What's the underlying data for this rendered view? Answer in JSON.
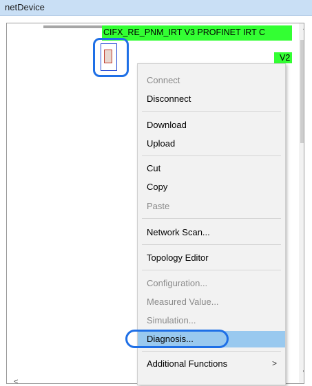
{
  "window": {
    "title": "netDevice"
  },
  "device": {
    "label": "CIFX_RE_PNM_IRT V3 PROFINET IRT C",
    "label_fragment": "V2"
  },
  "context_menu": {
    "items": [
      {
        "label": "Connect",
        "disabled": true
      },
      {
        "label": "Disconnect",
        "disabled": false
      },
      {
        "label": "Download",
        "disabled": false
      },
      {
        "label": "Upload",
        "disabled": false
      },
      {
        "label": "Cut",
        "disabled": false
      },
      {
        "label": "Copy",
        "disabled": false
      },
      {
        "label": "Paste",
        "disabled": true
      },
      {
        "label": "Network Scan...",
        "disabled": false
      },
      {
        "label": "Topology Editor",
        "disabled": false
      },
      {
        "label": "Configuration...",
        "disabled": true
      },
      {
        "label": "Measured Value...",
        "disabled": true
      },
      {
        "label": "Simulation...",
        "disabled": true
      },
      {
        "label": "Diagnosis...",
        "disabled": false,
        "highlighted": true
      },
      {
        "label": "Additional Functions",
        "disabled": false,
        "submenu": true
      }
    ],
    "submenu_arrow": ">"
  },
  "scrollbar": {
    "up": "^",
    "down": "v",
    "left": "<"
  },
  "colors": {
    "device_ok": "#33ff33",
    "annotation": "#1e6fe6",
    "selection": "#99c9ef"
  }
}
